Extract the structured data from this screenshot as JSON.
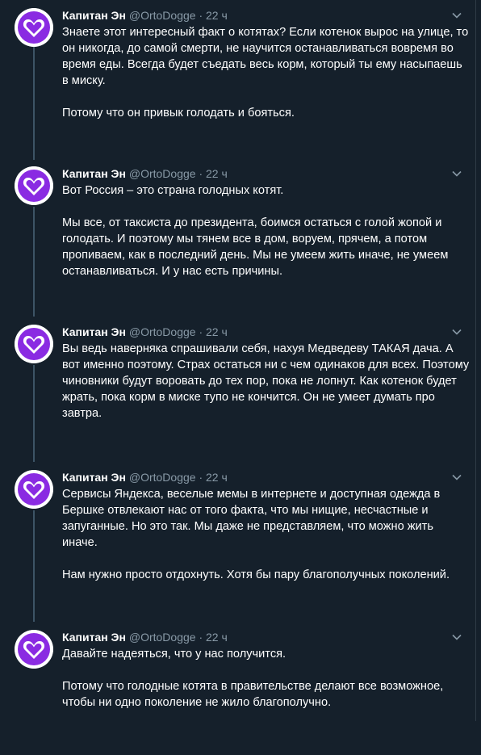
{
  "author": {
    "name": "Капитан Эн",
    "handle": "@OrtoDogge",
    "separator": "·",
    "avatar_icon": "heart-icon",
    "avatar_color": "#8a2be2"
  },
  "tweets": [
    {
      "time": "22 ч",
      "paragraphs": [
        "Знаете этот интересный факт о котятах? Если котенок вырос на улице, то он никогда, до самой смерти, не научится останавливаться вовремя во время еды. Всегда будет съедать весь корм, который ты ему насыпаешь в миску.",
        "Потому что он привык голодать и бояться."
      ]
    },
    {
      "time": "22 ч",
      "paragraphs": [
        "Вот Россия – это страна голодных котят.",
        "Мы все, от таксиста до президента, боимся остаться с голой жопой и голодать. И поэтому мы тянем все в дом, воруем, прячем, а потом пропиваем, как в последний день. Мы не умеем жить иначе, не умеем останавливаться. И у нас есть причины."
      ]
    },
    {
      "time": "22 ч",
      "paragraphs": [
        "Вы ведь наверняка спрашивали себя, нахуя Медведеву ТАКАЯ дача. А вот именно поэтому. Страх остаться ни с чем одинаков для всех. Поэтому чиновники будут воровать до тех пор, пока не лопнут. Как котенок будет жрать, пока корм в миске тупо не кончится. Он не умеет думать про завтра."
      ]
    },
    {
      "time": "22 ч",
      "paragraphs": [
        "Сервисы Яндекса, веселые мемы в интернете и доступная одежда в Бершке отвлекают нас от того факта, что мы нищие, несчастные и запуганные. Но это так. Мы даже не представляем, что можно жить иначе.",
        "Нам нужно просто отдохнуть. Хотя бы пару благополучных поколений."
      ]
    },
    {
      "time": "22 ч",
      "paragraphs": [
        "Давайте надеяться, что у нас получится.",
        "Потому что голодные котята в правительстве делают все возможное, чтобы ни одно поколение не жило благополучно."
      ]
    }
  ]
}
